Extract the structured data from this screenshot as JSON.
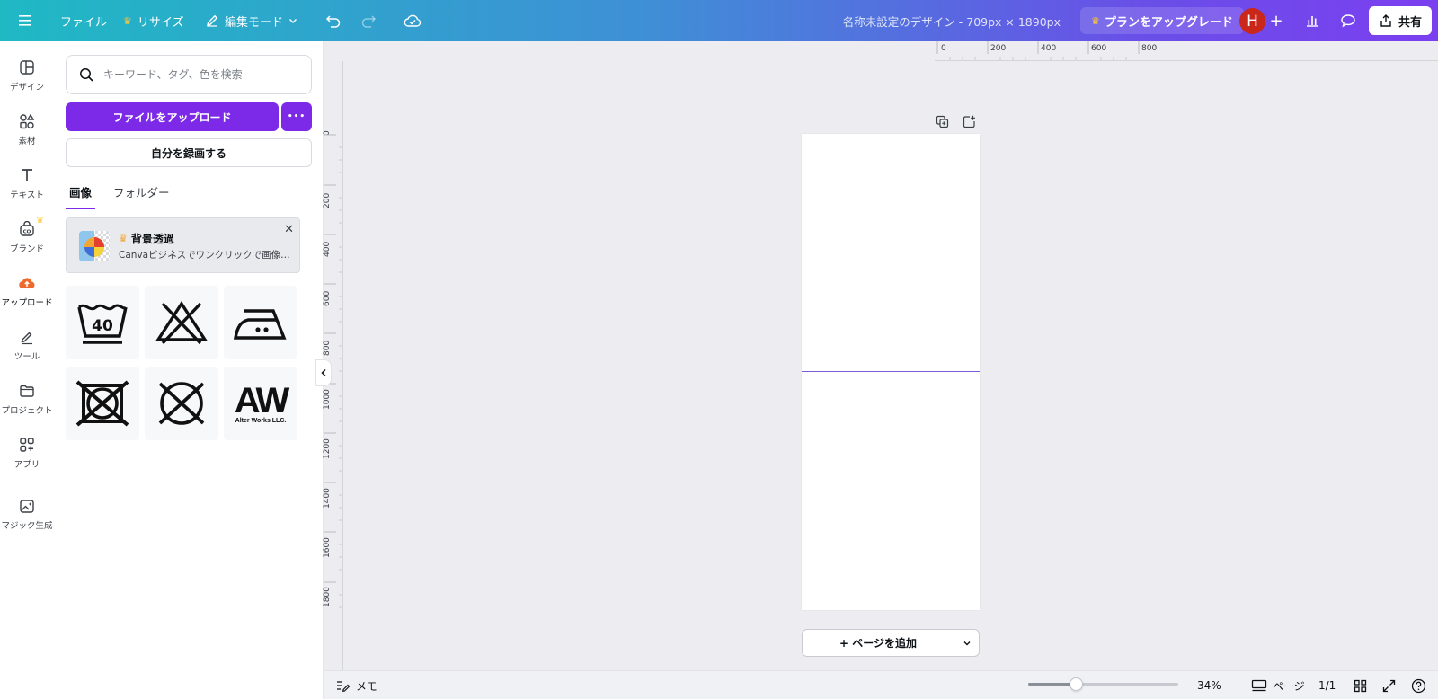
{
  "topbar": {
    "file_label": "ファイル",
    "resize_label": "リサイズ",
    "edit_mode_label": "編集モード",
    "design_title": "名称未設定のデザイン - 709px × 1890px",
    "upgrade_label": "プランをアップグレード",
    "avatar_initial": "H",
    "add_label": "+",
    "share_label": "共有"
  },
  "rail": {
    "items": [
      {
        "label": "デザイン"
      },
      {
        "label": "素材"
      },
      {
        "label": "テキスト"
      },
      {
        "label": "ブランド"
      },
      {
        "label": "アップロード"
      },
      {
        "label": "ツール"
      },
      {
        "label": "プロジェクト"
      },
      {
        "label": "アプリ"
      },
      {
        "label": "マジック生成"
      }
    ]
  },
  "panel": {
    "search_placeholder": "キーワード、タグ、色を検索",
    "upload_label": "ファイルをアップロード",
    "more_label": "•••",
    "record_label": "自分を録画する",
    "tabs": [
      {
        "label": "画像"
      },
      {
        "label": "フォルダー"
      }
    ],
    "promo": {
      "title": "背景透過",
      "subtitle": "Canvaビジネスでワンクリックで画像の..."
    },
    "images": [
      {
        "icon": "wash-40-icon",
        "text": "40"
      },
      {
        "icon": "no-bleach-icon"
      },
      {
        "icon": "iron-medium-icon"
      },
      {
        "icon": "no-tumble-dry-icon"
      },
      {
        "icon": "no-dry-clean-icon"
      },
      {
        "icon": "alter-works-logo",
        "text": "AW",
        "caption": "Alter Works LLC."
      }
    ]
  },
  "rulers": {
    "top": [
      "0",
      "200",
      "400",
      "600",
      "800"
    ],
    "left": [
      "0",
      "200",
      "400",
      "600",
      "800",
      "1000",
      "1200",
      "1400",
      "1600",
      "1800"
    ]
  },
  "canvas": {
    "add_page_label": "+ ページを追加"
  },
  "bottombar": {
    "notes_label": "メモ",
    "zoom_label": "34%",
    "zoom_value": 0.34,
    "pages_label": "ページ",
    "page_count": "1/1"
  },
  "colors": {
    "accent": "#7d2ae8",
    "avatar": "#c9271a",
    "upload_active": "#ee6a2c",
    "crown": "#ffc83d"
  }
}
